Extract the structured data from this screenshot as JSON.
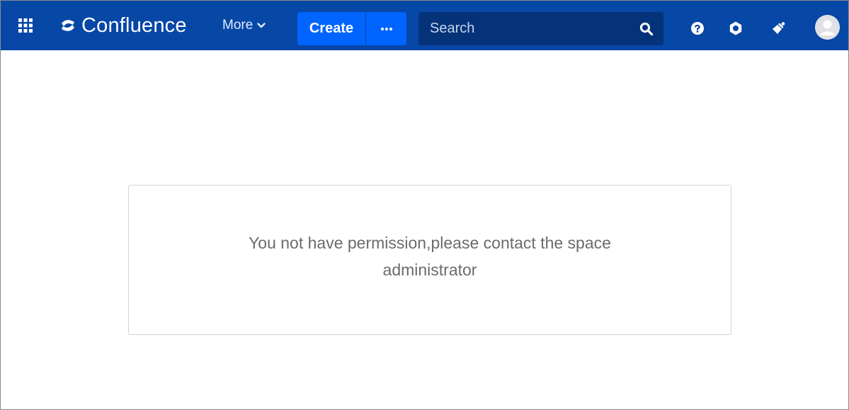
{
  "header": {
    "logo_text": "Confluence",
    "more_label": "More",
    "create_label": "Create",
    "search": {
      "placeholder": "Search"
    },
    "icons": {
      "apps": "app-switcher-icon",
      "logo": "confluence-logo-icon",
      "more_chevron": "chevron-down-icon",
      "create_more": "ellipsis-icon",
      "search": "search-icon",
      "help": "help-icon",
      "settings": "settings-icon",
      "notifications": "megaphone-icon",
      "avatar": "user-avatar-icon"
    },
    "colors": {
      "bar": "#0747a6",
      "create": "#0065ff",
      "search_bg": "#05337a"
    }
  },
  "main": {
    "message": "You not have permission,please contact the space administrator"
  }
}
